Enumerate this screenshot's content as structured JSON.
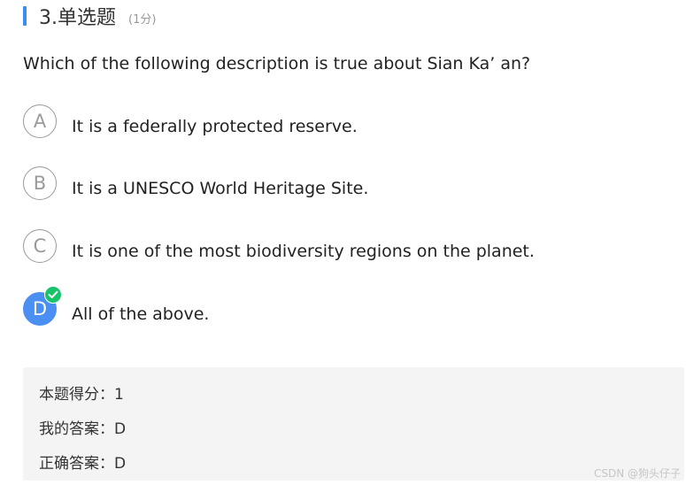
{
  "question_header": {
    "title": "3.单选题",
    "score": "(1分)",
    "accent_color": "#3b8cf5"
  },
  "question": {
    "text": "Which of the following description is true about Sian Ka’ an?"
  },
  "options": [
    {
      "letter": "A",
      "text": "It is a federally protected reserve.",
      "selected": false
    },
    {
      "letter": "B",
      "text": "It is a UNESCO World Heritage Site.",
      "selected": false
    },
    {
      "letter": "C",
      "text": "It is one of the most biodiversity regions on the planet.",
      "selected": false
    },
    {
      "letter": "D",
      "text": "All of the above.",
      "selected": true,
      "badge_icon": "check-circle-icon",
      "badge_color": "#18c46a",
      "selected_color": "#4b8ff2"
    }
  ],
  "result": {
    "score_label": "本题得分：",
    "score_value": "1",
    "my_answer_label": "我的答案：",
    "my_answer_value": "D",
    "correct_answer_label": "正确答案：",
    "correct_answer_value": "D"
  },
  "watermark": "CSDN @狗头仔子"
}
